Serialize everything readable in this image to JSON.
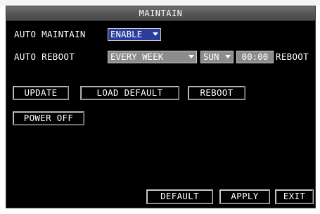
{
  "window": {
    "title": "MAINTAIN"
  },
  "settings": {
    "auto_maintain": {
      "label": "AUTO MAINTAIN",
      "value": "ENABLE"
    },
    "auto_reboot": {
      "label": "AUTO REBOOT",
      "frequency": "EVERY WEEK",
      "day": "SUN",
      "time": "00:00",
      "suffix": "REBOOT"
    }
  },
  "actions": {
    "update": "UPDATE",
    "load_default": "LOAD DEFAULT",
    "reboot": "REBOOT",
    "power_off": "POWER OFF"
  },
  "footer": {
    "default": "DEFAULT",
    "apply": "APPLY",
    "exit": "EXIT"
  },
  "colors": {
    "background": "#000000",
    "titlebar": "#5a5a5a",
    "active_field": "#2a3d9b",
    "field": "#8c8c8c"
  }
}
